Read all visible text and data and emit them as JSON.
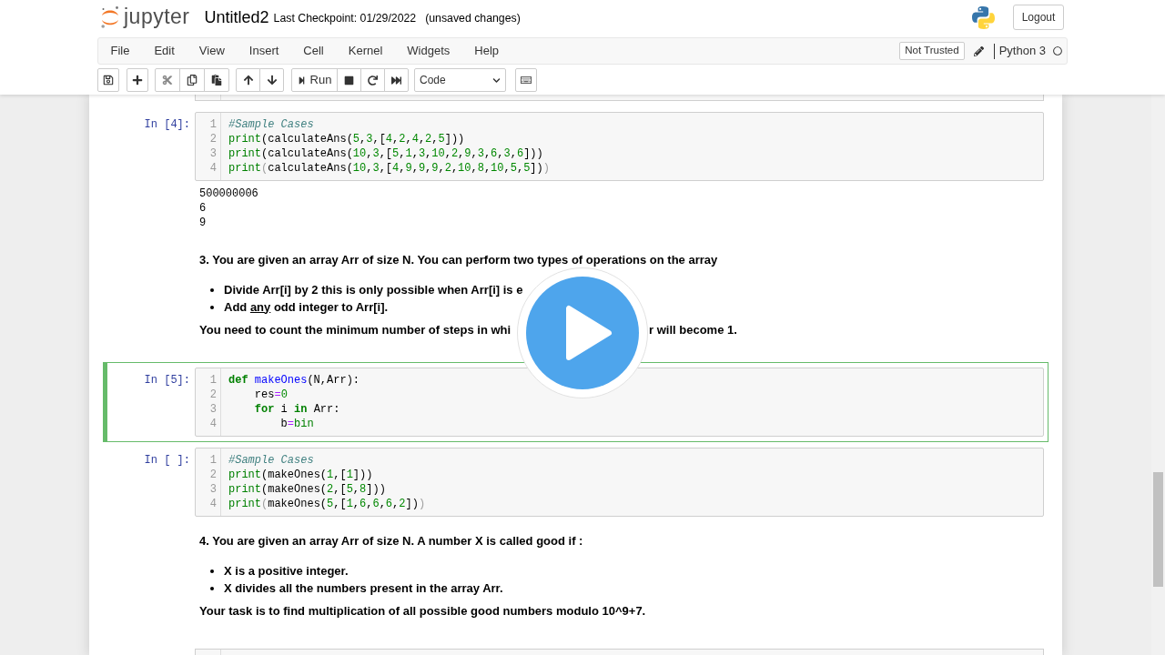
{
  "header": {
    "logo_text": "jupyter",
    "notebook_name": "Untitled2",
    "checkpoint": "Last Checkpoint: 01/29/2022",
    "save_status": "(unsaved changes)",
    "logout": "Logout"
  },
  "menu": [
    "File",
    "Edit",
    "View",
    "Insert",
    "Cell",
    "Kernel",
    "Widgets",
    "Help"
  ],
  "notebook_status": {
    "trust": "Not Trusted",
    "kernel_name": "Python 3",
    "kernel_busy": false
  },
  "toolbar": {
    "run_label": "Run",
    "cell_type": "Code"
  },
  "cells": [
    {
      "kind": "code",
      "selected": false,
      "prompt": "In [4]:",
      "lines": [
        {
          "number": "1",
          "tokens": [
            {
              "text": "#Sample Cases",
              "kind": "comment"
            }
          ]
        },
        {
          "number": "2",
          "tokens": [
            {
              "text": "print",
              "kind": "builtin"
            },
            {
              "text": "(calculateAns(5,3,[4,2,4,2,5]))",
              "kind": "code"
            }
          ]
        },
        {
          "number": "3",
          "tokens": [
            {
              "text": "print",
              "kind": "builtin"
            },
            {
              "text": "(calculateAns(10,3,[5,1,3,10,2,9,3,6,3,6]))",
              "kind": "code"
            }
          ]
        },
        {
          "number": "4",
          "tokens": [
            {
              "text": "print",
              "kind": "builtin"
            },
            {
              "text": "(",
              "kind": "bracket_match"
            },
            {
              "text": "calculateAns(10,3,[4,9,9,9,2,10,8,10,5,5])",
              "kind": "code"
            },
            {
              "text": ")",
              "kind": "bracket_match"
            }
          ]
        }
      ],
      "output": [
        "500000006",
        "6",
        "9"
      ]
    },
    {
      "kind": "markdown",
      "selected": false,
      "blocks": [
        {
          "kind": "paragraph",
          "parts": [
            "3. You are given an array Arr of size N. You can perform two types of operations on the array"
          ]
        },
        {
          "kind": "list",
          "items": [
            {
              "segments": [
                {
                  "text": "Divide Arr[i] by 2 this is only possible when Arr[i] is e",
                  "underline": false
                }
              ]
            },
            {
              "segments": [
                {
                  "text": "Add ",
                  "underline": false
                },
                {
                  "text": "any",
                  "underline": true
                },
                {
                  "text": " odd integer to Arr[i].",
                  "underline": false
                }
              ]
            }
          ]
        },
        {
          "kind": "paragraph",
          "parts": [
            "You need to count the minimum number of steps in whi",
            "r will become 1."
          ]
        }
      ]
    },
    {
      "kind": "code",
      "selected": true,
      "prompt": "In [5]:",
      "lines": [
        {
          "number": "1",
          "tokens": [
            {
              "text": "def",
              "kind": "keyword"
            },
            {
              "text": " makeOnes",
              "kind": "defname"
            },
            {
              "text": "(N,Arr):",
              "kind": "code"
            }
          ]
        },
        {
          "number": "2",
          "tokens": [
            {
              "text": "    res",
              "kind": "code"
            },
            {
              "text": "=",
              "kind": "operator"
            },
            {
              "text": "0",
              "kind": "code"
            }
          ]
        },
        {
          "number": "3",
          "tokens": [
            {
              "text": "    for",
              "kind": "keyword"
            },
            {
              "text": " i ",
              "kind": "code"
            },
            {
              "text": "in",
              "kind": "keyword"
            },
            {
              "text": " Arr:",
              "kind": "code"
            }
          ]
        },
        {
          "number": "4",
          "tokens": [
            {
              "text": "        b",
              "kind": "code"
            },
            {
              "text": "=",
              "kind": "operator"
            },
            {
              "text": "bin",
              "kind": "builtin"
            }
          ]
        }
      ]
    },
    {
      "kind": "code",
      "selected": false,
      "prompt": "In [ ]:",
      "lines": [
        {
          "number": "1",
          "tokens": [
            {
              "text": "#Sample Cases",
              "kind": "comment"
            }
          ]
        },
        {
          "number": "2",
          "tokens": [
            {
              "text": "print",
              "kind": "builtin"
            },
            {
              "text": "(makeOnes(1,[1]))",
              "kind": "code"
            }
          ]
        },
        {
          "number": "3",
          "tokens": [
            {
              "text": "print",
              "kind": "builtin"
            },
            {
              "text": "(makeOnes(2,[5,8]))",
              "kind": "code"
            }
          ]
        },
        {
          "number": "4",
          "tokens": [
            {
              "text": "print",
              "kind": "builtin"
            },
            {
              "text": "(",
              "kind": "bracket_match"
            },
            {
              "text": "makeOnes(5,[1,6,6,6,2])",
              "kind": "code"
            },
            {
              "text": ")",
              "kind": "bracket_match"
            }
          ]
        }
      ]
    },
    {
      "kind": "markdown",
      "selected": false,
      "blocks": [
        {
          "kind": "paragraph",
          "parts": [
            "4. You are given an array Arr of size N. A number X is called good if :"
          ]
        },
        {
          "kind": "list",
          "items": [
            {
              "segments": [
                {
                  "text": "X is a positive integer.",
                  "underline": false
                }
              ]
            },
            {
              "segments": [
                {
                  "text": "X divides all the numbers present in the array Arr.",
                  "underline": false
                }
              ]
            }
          ]
        },
        {
          "kind": "paragraph",
          "parts": [
            "Your task is to find multiplication of all possible good numbers modulo 10^9+7."
          ]
        }
      ]
    }
  ]
}
